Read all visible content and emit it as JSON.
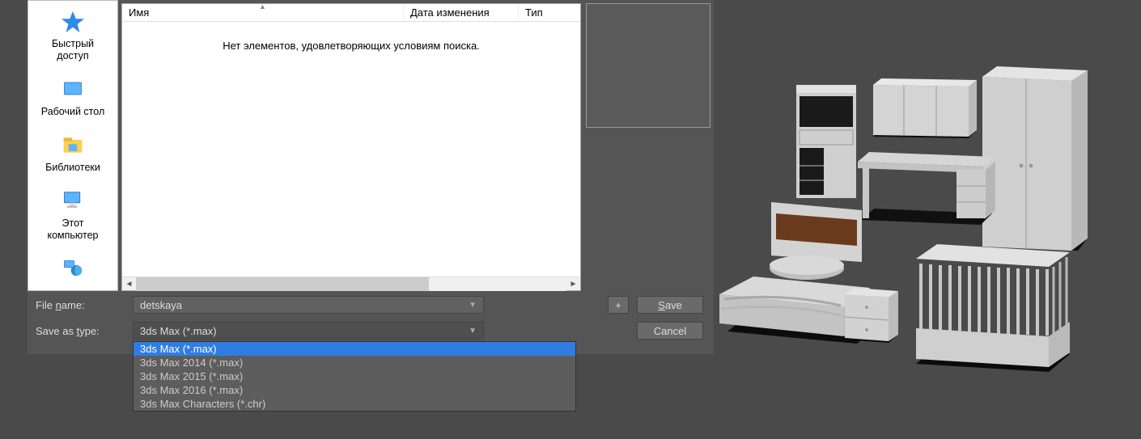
{
  "places": {
    "quick_access": "Быстрый\nдоступ",
    "desktop": "Рабочий стол",
    "libraries": "Библиотеки",
    "this_pc": "Этот\nкомпьютер"
  },
  "filelist": {
    "columns": {
      "name": "Имя",
      "date": "Дата изменения",
      "type": "Тип"
    },
    "empty_message": "Нет элементов, удовлетворяющих условиям поиска."
  },
  "fields": {
    "filename_label": "File name:",
    "filename_value": "detskaya",
    "savetype_label": "Save as type:",
    "savetype_value": "3ds Max (*.max)"
  },
  "dropdown": [
    "3ds Max (*.max)",
    "3ds Max 2014 (*.max)",
    "3ds Max 2015 (*.max)",
    "3ds Max 2016 (*.max)",
    "3ds Max Characters (*.chr)"
  ],
  "buttons": {
    "plus": "+",
    "save": "Save",
    "cancel": "Cancel"
  }
}
